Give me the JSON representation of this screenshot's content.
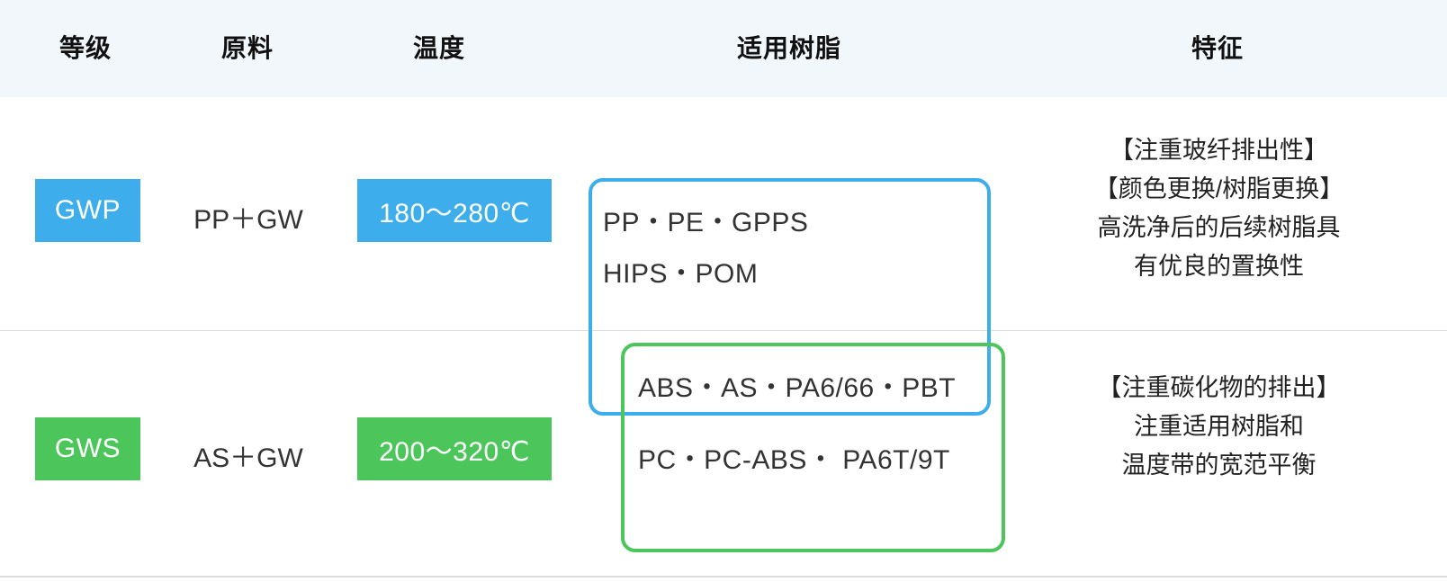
{
  "table": {
    "headers": [
      {
        "label": "等级"
      },
      {
        "label": "原料"
      },
      {
        "label": "温度"
      },
      {
        "label": "适用树脂"
      },
      {
        "label": "特征"
      }
    ],
    "rows": [
      {
        "grade": "GWP",
        "grade_color": "#3daeeb",
        "material": "PP＋GW",
        "temperature": "180〜280℃",
        "temperature_color": "#3daeeb",
        "resins": [
          "PP・PE・GPPS",
          "HIPS・POM"
        ],
        "features": [
          "【注重玻纤排出性】",
          "【颜色更换/树脂更换】",
          "高洗净后的后续树脂具",
          "有优良的置换性"
        ]
      },
      {
        "grade": "GWS",
        "grade_color": "#4cc65a",
        "material": "AS＋GW",
        "temperature": "200〜320℃",
        "temperature_color": "#4cc65a",
        "resins": [
          "ABS・AS・PA6/66・PBT",
          "PC・PC-ABS・ PA6T/9T"
        ],
        "features": [
          "【注重碳化物的排出】",
          "注重适用树脂和",
          "温度带的宽范平衡"
        ]
      }
    ],
    "header_background": "#f2f7fb",
    "divider_color": "#dcdcdc"
  }
}
